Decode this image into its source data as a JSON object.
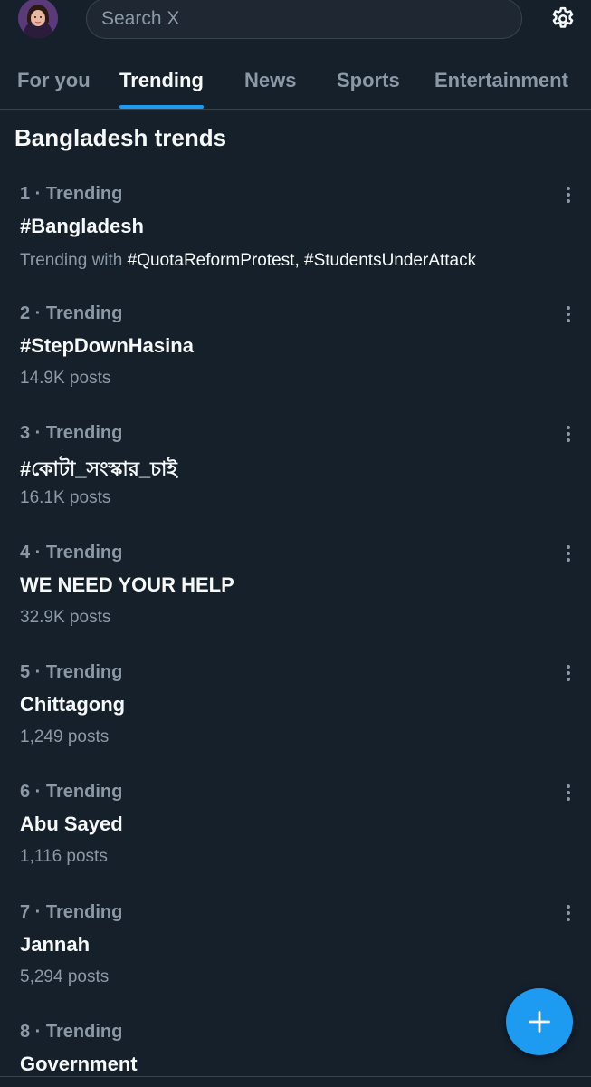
{
  "search": {
    "placeholder": "Search X"
  },
  "tabs": [
    {
      "label": "For you",
      "active": false
    },
    {
      "label": "Trending",
      "active": true
    },
    {
      "label": "News",
      "active": false
    },
    {
      "label": "Sports",
      "active": false
    },
    {
      "label": "Entertainment",
      "active": false
    }
  ],
  "section": {
    "title": "Bangladesh trends"
  },
  "trends": [
    {
      "meta": "1 · Trending",
      "name": "#Bangladesh",
      "sub_prefix": "Trending with ",
      "sub_tags": "#QuotaReformProtest, #StudentsUnderAttack"
    },
    {
      "meta": "2 · Trending",
      "name": "#StepDownHasina",
      "sub": "14.9K posts"
    },
    {
      "meta": "3 · Trending",
      "name": "#কোটা_সংস্কার_চাই",
      "sub": "16.1K posts"
    },
    {
      "meta": "4 · Trending",
      "name": "WE NEED YOUR HELP",
      "sub": "32.9K posts"
    },
    {
      "meta": "5 · Trending",
      "name": "Chittagong",
      "sub": "1,249 posts"
    },
    {
      "meta": "6 · Trending",
      "name": "Abu Sayed",
      "sub": "1,116 posts"
    },
    {
      "meta": "7 · Trending",
      "name": "Jannah",
      "sub": "5,294 posts"
    },
    {
      "meta": "8 · Trending",
      "name": "Government",
      "sub": ""
    }
  ],
  "colors": {
    "background": "#15202b",
    "accent": "#1d9bf0",
    "secondary_text": "#8b98a5",
    "primary_text": "#f7f9f9"
  },
  "icons": {
    "settings": "gear-icon",
    "more": "more-dots-icon",
    "compose": "plus-icon"
  }
}
